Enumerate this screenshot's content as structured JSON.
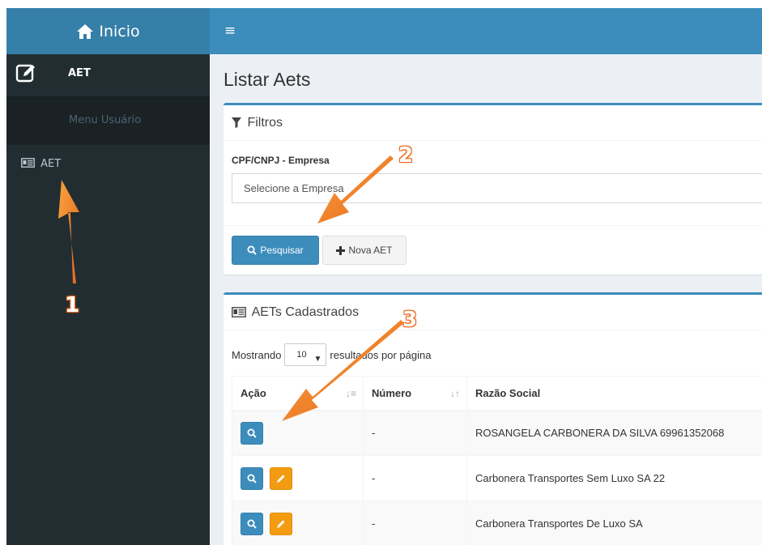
{
  "topbar": {
    "brand_label": "Inicio",
    "menu_toggle": "≡"
  },
  "sidebar": {
    "user_name": "AET",
    "menu_header": "Menu Usuário",
    "items": [
      {
        "label": "AET"
      }
    ]
  },
  "main": {
    "page_title": "Listar Aets",
    "filters": {
      "title": "Filtros",
      "field_label": "CPF/CNPJ - Empresa",
      "select_placeholder": "Selecione a Empresa",
      "search_button": "Pesquisar",
      "new_button": "Nova AET"
    },
    "list": {
      "title": "AETs Cadastrados",
      "length_prefix": "Mostrando",
      "length_value": "10",
      "length_suffix": "resultados por página",
      "columns": [
        "Ação",
        "Número",
        "Razão Social"
      ],
      "rows": [
        {
          "numero": "-",
          "razao_social": "ROSANGELA CARBONERA DA SILVA 69961352068",
          "has_edit": false
        },
        {
          "numero": "-",
          "razao_social": "Carbonera Transportes Sem Luxo SA 22",
          "has_edit": true
        },
        {
          "numero": "-",
          "razao_social": "Carbonera Transportes De Luxo SA",
          "has_edit": true
        }
      ]
    }
  },
  "annotations": {
    "step1": "1",
    "step2": "2",
    "step3": "3"
  },
  "colors": {
    "accent": "#3c8dbc",
    "sidebar": "#222d32",
    "warning": "#f39c12",
    "arrow": "#f07a1a"
  }
}
